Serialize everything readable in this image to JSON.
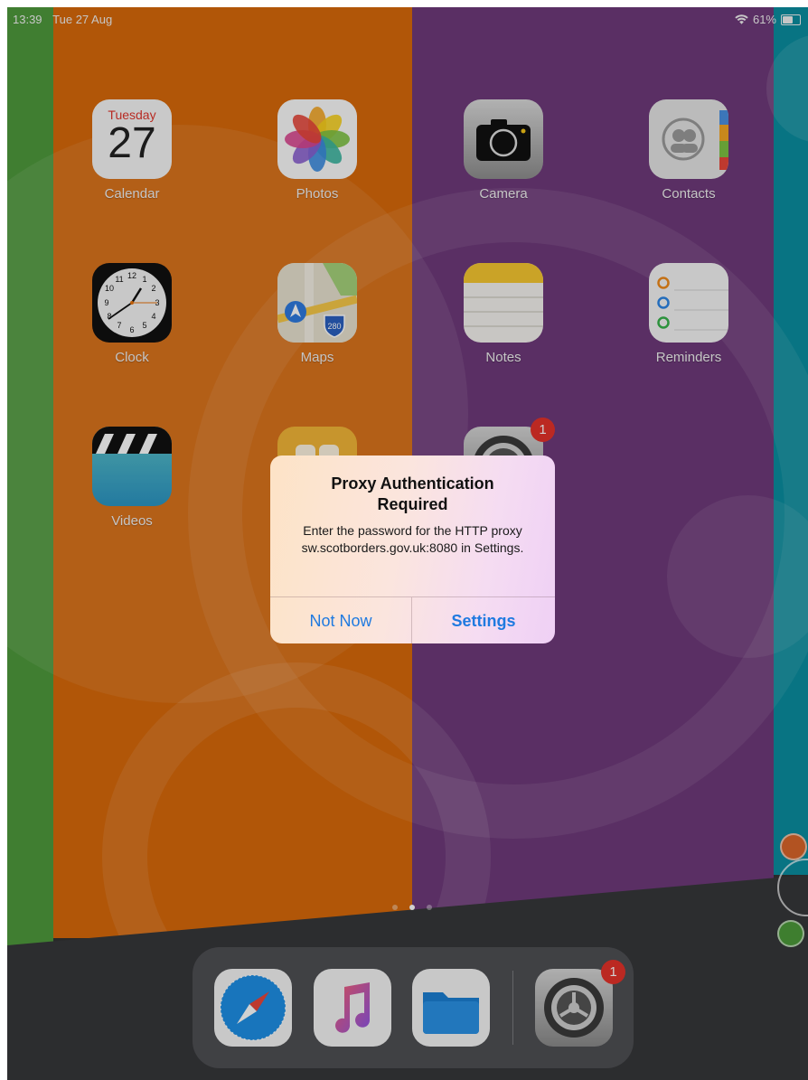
{
  "status_bar": {
    "time": "13:39",
    "date": "Tue 27 Aug",
    "battery": "61%"
  },
  "home": {
    "apps": [
      {
        "label": "Calendar",
        "day_name": "Tuesday",
        "day_number": "27"
      },
      {
        "label": "Photos"
      },
      {
        "label": "Camera"
      },
      {
        "label": "Contacts"
      },
      {
        "label": "Clock"
      },
      {
        "label": "Maps",
        "shield_text": "280"
      },
      {
        "label": "Notes"
      },
      {
        "label": "Reminders"
      },
      {
        "label": "Videos"
      },
      {
        "label": ""
      },
      {
        "label": "Settings",
        "badge": "1"
      }
    ],
    "page_count": 3,
    "current_page": 2
  },
  "alert": {
    "title": "Proxy Authentication Required",
    "message": "Enter the password for the HTTP proxy sw.scotborders.gov.uk:8080 in Settings.",
    "buttons": {
      "cancel": "Not Now",
      "confirm": "Settings"
    }
  },
  "dock": {
    "apps": [
      {
        "name": "safari-icon"
      },
      {
        "name": "music-icon"
      },
      {
        "name": "files-icon"
      },
      {
        "name": "settings-icon",
        "badge": "1"
      }
    ]
  },
  "colors": {
    "green": "#4f9a3c",
    "orange": "#d8690a",
    "purple": "#6e3a7a",
    "teal": "#0a8ea0",
    "alert_button": "#1f7ae0",
    "badge": "#e5322a"
  }
}
